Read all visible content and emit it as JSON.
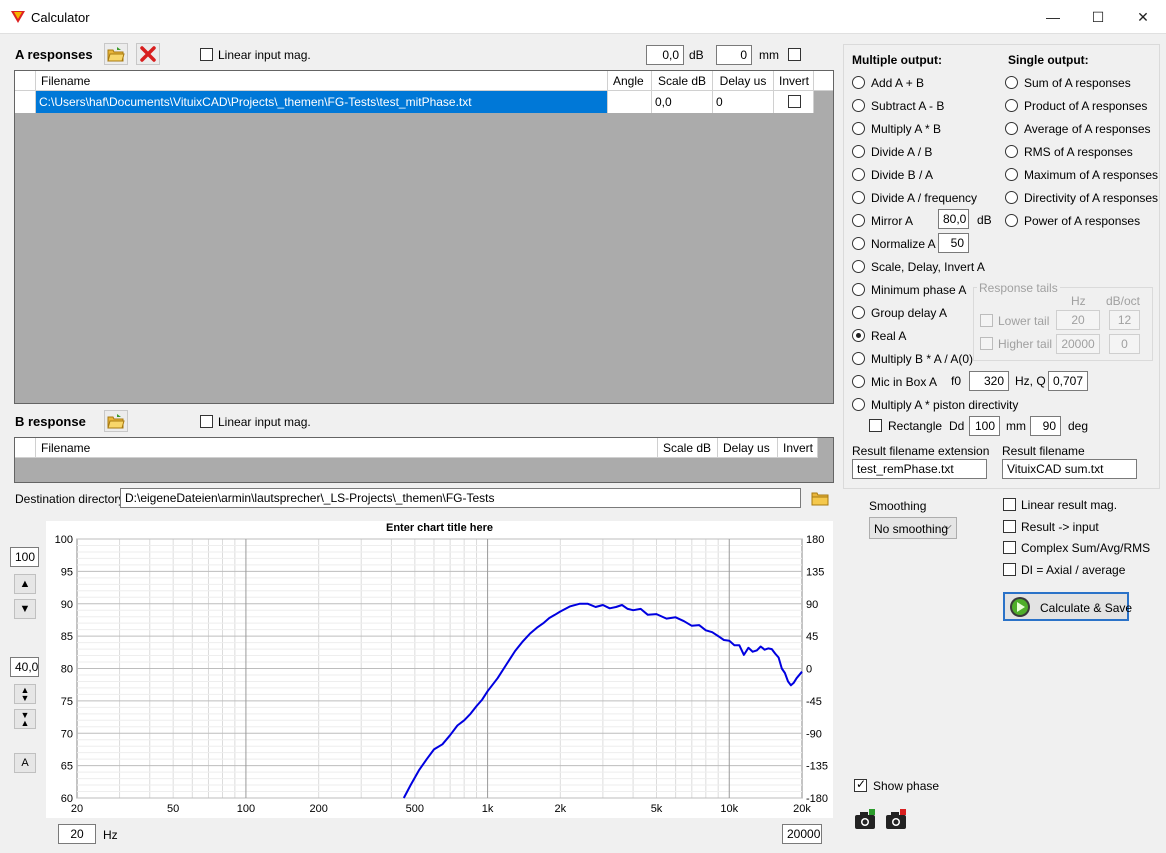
{
  "window": {
    "title": "Calculator",
    "minimize": "—",
    "maximize": "☐",
    "close": "✕"
  },
  "a_responses": {
    "label": "A responses",
    "linear_input_mag": "Linear input mag.",
    "db_value": "0,0",
    "db_unit": "dB",
    "mm_value": "0",
    "mm_unit": "mm",
    "columns": [
      "Filename",
      "Angle",
      "Scale dB",
      "Delay us",
      "Invert"
    ],
    "rows": [
      {
        "filename": "C:\\Users\\haf\\Documents\\VituixCAD\\Projects\\_themen\\FG-Tests\\test_mitPhase.txt",
        "angle": "",
        "scale_db": "0,0",
        "delay_us": "0",
        "invert": false
      }
    ]
  },
  "b_response": {
    "label": "B response",
    "linear_input_mag": "Linear input mag.",
    "columns": [
      "Filename",
      "Scale dB",
      "Delay us",
      "Invert"
    ]
  },
  "destination": {
    "label": "Destination directory",
    "value": "D:\\eigeneDateien\\armin\\lautsprecher\\_LS-Projects\\_themen\\FG-Tests"
  },
  "multiple_output": {
    "label": "Multiple output:",
    "options": [
      "Add A + B",
      "Subtract A - B",
      "Multiply A * B",
      "Divide A / B",
      "Divide B / A",
      "Divide A / frequency",
      "Mirror A",
      "Normalize A",
      "Scale, Delay, Invert A",
      "Minimum phase A",
      "Group delay A",
      "Real A",
      "Multiply B * A / A(0)",
      "Mic in Box A",
      "Multiply A * piston directivity"
    ],
    "selected": "Real A",
    "mirror_value": "80,0",
    "mirror_unit": "dB",
    "normalize_value": "50",
    "mic_f0_label": "f0",
    "mic_f0": "320",
    "mic_q_label": "Hz, Q",
    "mic_q": "0,707",
    "rectangle_label": "Rectangle",
    "dd_label": "Dd",
    "dd_value": "100",
    "dd_unit": "mm",
    "deg_value": "90",
    "deg_unit": "deg"
  },
  "single_output": {
    "label": "Single output:",
    "options": [
      "Sum of A responses",
      "Product of A responses",
      "Average of A responses",
      "RMS of A responses",
      "Maximum of A responses",
      "Directivity of A responses",
      "Power of A responses"
    ]
  },
  "response_tails": {
    "label": "Response tails",
    "hz_header": "Hz",
    "dboct_header": "dB/oct",
    "lower_label": "Lower tail",
    "lower_hz": "20",
    "lower_db": "12",
    "higher_label": "Higher tail",
    "higher_hz": "20000",
    "higher_db": "0"
  },
  "result": {
    "ext_label": "Result filename extension",
    "ext_value": "test_remPhase.txt",
    "file_label": "Result filename",
    "file_value": "VituixCAD sum.txt"
  },
  "smoothing": {
    "label": "Smoothing",
    "value": "No smoothing"
  },
  "options": {
    "linear_result_mag": "Linear result mag.",
    "result_input": "Result -> input",
    "complex": "Complex Sum/Avg/RMS",
    "di": "DI = Axial / average",
    "show_phase": "Show phase"
  },
  "calc_button": "Calculate & Save",
  "chart_controls": {
    "top_value": "100",
    "range_value": "40,0",
    "auto_label": "A",
    "fmin": "20",
    "fmin_unit": "Hz",
    "fmax": "20000"
  },
  "chart_data": {
    "type": "line",
    "title": "Enter chart title here",
    "xscale": "log",
    "xlim": [
      20,
      20000
    ],
    "ylim": [
      60,
      100
    ],
    "y2lim": [
      -180,
      180
    ],
    "grid": true,
    "x_ticks": [
      "20",
      "50",
      "100",
      "200",
      "500",
      "1k",
      "2k",
      "5k",
      "10k",
      "20k"
    ],
    "x_tick_values": [
      20,
      50,
      100,
      200,
      500,
      1000,
      2000,
      5000,
      10000,
      20000
    ],
    "y_ticks": [
      "100",
      "95",
      "90",
      "85",
      "80",
      "75",
      "70",
      "65",
      "60"
    ],
    "y2_ticks": [
      "180",
      "135",
      "90",
      "45",
      "0",
      "-45",
      "-90",
      "-135",
      "-180"
    ],
    "series": [
      {
        "color": "#0000e0",
        "x": [
          450,
          480,
          520,
          560,
          600,
          650,
          700,
          750,
          800,
          850,
          900,
          950,
          1000,
          1100,
          1200,
          1300,
          1400,
          1500,
          1600,
          1700,
          1800,
          1900,
          2000,
          2200,
          2400,
          2600,
          2800,
          3000,
          3200,
          3400,
          3600,
          3800,
          4000,
          4300,
          4600,
          5000,
          5500,
          6000,
          6500,
          7000,
          7500,
          8000,
          8500,
          9000,
          9500,
          10000,
          10500,
          11000,
          11500,
          12000,
          12500,
          13000,
          13500,
          14000,
          14500,
          15000,
          15500,
          16000,
          16500,
          17000,
          17500,
          18000,
          18500,
          19000,
          20000
        ],
        "y": [
          60.0,
          62.0,
          64.3,
          66.0,
          67.5,
          68.3,
          69.7,
          71.2,
          72.0,
          73.0,
          74.2,
          75.2,
          76.5,
          78.5,
          80.7,
          82.7,
          84.2,
          85.4,
          86.3,
          87.0,
          87.8,
          88.3,
          88.8,
          89.6,
          90.0,
          90.0,
          89.5,
          89.8,
          89.3,
          89.5,
          89.8,
          89.2,
          89.0,
          89.2,
          88.3,
          88.4,
          87.7,
          87.9,
          87.3,
          86.6,
          86.7,
          85.9,
          85.6,
          85.0,
          84.4,
          84.3,
          83.6,
          83.6,
          82.1,
          83.2,
          82.6,
          82.8,
          83.4,
          82.9,
          83.1,
          83.0,
          82.3,
          81.7,
          80.0,
          79.3,
          78.0,
          77.4,
          77.8,
          78.5,
          79.5
        ]
      }
    ]
  }
}
